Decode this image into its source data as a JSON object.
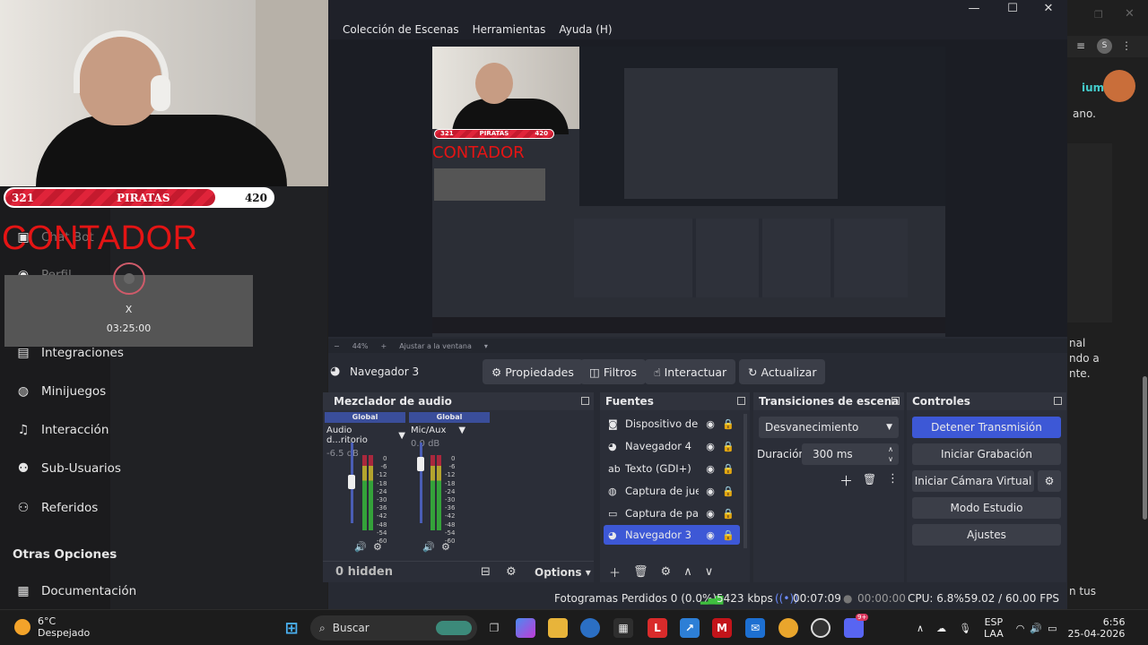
{
  "webpage": {
    "nav_items": [
      {
        "icon": "chat-bot-icon",
        "label": "Chat Bot"
      },
      {
        "icon": "profile-icon",
        "label": "Perfil"
      },
      {
        "icon": "integrations-icon",
        "label": "Integraciones"
      },
      {
        "icon": "gamepad-icon",
        "label": "Minijuegos"
      },
      {
        "icon": "music-note-icon",
        "label": "Interacción"
      },
      {
        "icon": "users-icon",
        "label": "Sub-Usuarios"
      },
      {
        "icon": "referrals-icon",
        "label": "Referidos"
      }
    ],
    "section_other": "Otras Opciones",
    "nav_docs": "Documentación"
  },
  "overlay": {
    "team_left_score": "321",
    "team_name": "PIRATAS",
    "team_right_score": "420",
    "counter_title": "CONTADOR",
    "close_x": "X",
    "timer": "03:25:00"
  },
  "right_page": {
    "fragments": [
      "ium",
      "ano.",
      "nal",
      "ndo a",
      "nte.",
      "n tus"
    ]
  },
  "obs": {
    "menu": [
      "Colección de Escenas",
      "Herramientas",
      "Ayuda (H)"
    ],
    "preview_zoom": "44%",
    "preview_fit": "Ajustar a la ventana",
    "selected_source_name": "Navegador 3",
    "toolbar": {
      "properties": "Propiedades",
      "filters": "Filtros",
      "interact": "Interactuar",
      "refresh": "Actualizar"
    },
    "mixer": {
      "title": "Mezclador de audio",
      "channels": [
        {
          "global": "Global",
          "name": "Audio d...ritorio",
          "db": "-6.5 dB",
          "level": 0.72
        },
        {
          "global": "Global",
          "name": "Mic/Aux",
          "db": "0.0 dB",
          "level": 0.95
        }
      ],
      "scale": [
        "0",
        "-6",
        "-12",
        "-18",
        "-24",
        "-30",
        "-36",
        "-42",
        "-48",
        "-54",
        "-60"
      ],
      "hidden": "0 hidden",
      "options": "Options"
    },
    "sources": {
      "title": "Fuentes",
      "items": [
        {
          "icon": "camera-icon",
          "label": "Dispositivo de captura de video"
        },
        {
          "icon": "globe-icon",
          "label": "Navegador 4"
        },
        {
          "icon": "text-icon",
          "label": "Texto (GDI+)"
        },
        {
          "icon": "gamepad-icon",
          "label": "Captura de juego"
        },
        {
          "icon": "monitor-icon",
          "label": "Captura de pantalla"
        },
        {
          "icon": "globe-icon",
          "label": "Navegador 3"
        }
      ]
    },
    "transitions": {
      "title": "Transiciones de escena",
      "selected": "Desvanecimiento",
      "duration_label": "Duración",
      "duration_value": "300 ms"
    },
    "controls": {
      "title": "Controles",
      "stop_stream": "Detener Transmisión",
      "start_recording": "Iniciar Grabación",
      "start_virtual_cam": "Iniciar Cámara Virtual",
      "studio_mode": "Modo Estudio",
      "settings": "Ajustes"
    },
    "status": {
      "dropped_frames": "Fotogramas Perdidos 0 (0.0%)",
      "bitrate": "5423 kbps",
      "stream_time": "00:07:09",
      "rec_time": "00:00:00",
      "cpu": "CPU: 6.8%",
      "fps": "59.02 / 60.00 FPS"
    }
  },
  "taskbar": {
    "temperature": "6°C",
    "condition": "Despejado",
    "search_placeholder": "Buscar",
    "lang": "ESP",
    "layout": "LAA",
    "time": "6:56",
    "date": "25-04-2026",
    "notif_badge": "9+"
  },
  "colors": {
    "accent": "#3d58d6",
    "obs_bg": "#272a33",
    "counter_red": "#e41414"
  }
}
